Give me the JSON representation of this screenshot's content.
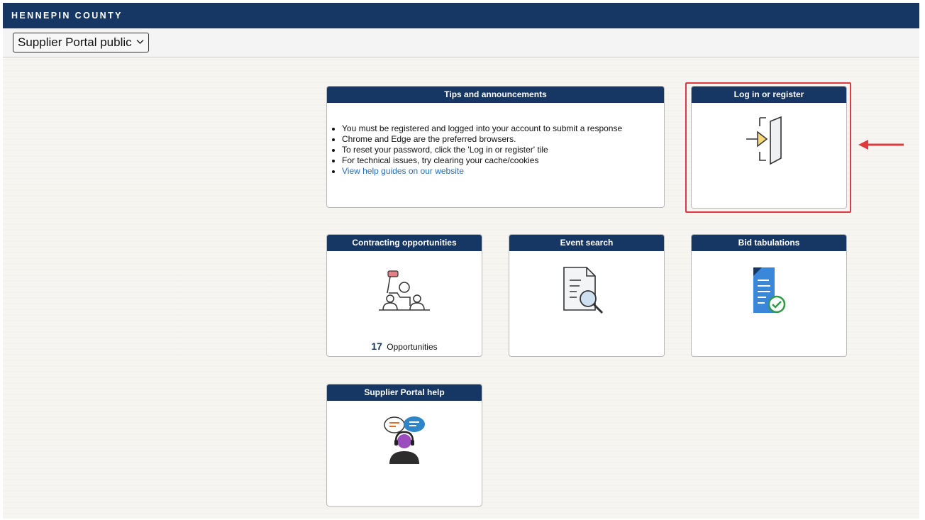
{
  "header": {
    "org_name": "HENNEPIN COUNTY"
  },
  "portal_select": {
    "value": "Supplier Portal public"
  },
  "tiles": {
    "tips": {
      "title": "Tips and announcements",
      "items": [
        "You must be registered and logged into your account to submit a response",
        "Chrome and Edge are the preferred browsers.",
        "To reset your password, click the 'Log in or register' tile",
        "For technical issues, try clearing your cache/cookies"
      ],
      "link": "View help guides on our website"
    },
    "login": {
      "title": "Log in or register",
      "icon": "door-enter-icon"
    },
    "contracting": {
      "title": "Contracting opportunities",
      "count": "17",
      "count_label": "Opportunities",
      "icon": "presentation-icon"
    },
    "event_search": {
      "title": "Event search",
      "icon": "document-search-icon"
    },
    "bid_tabulations": {
      "title": "Bid tabulations",
      "icon": "document-check-icon"
    },
    "help": {
      "title": "Supplier Portal help",
      "icon": "support-agent-icon"
    }
  },
  "colors": {
    "header_bg": "#163764",
    "highlight": "#e0393e",
    "link": "#2a6db3"
  }
}
